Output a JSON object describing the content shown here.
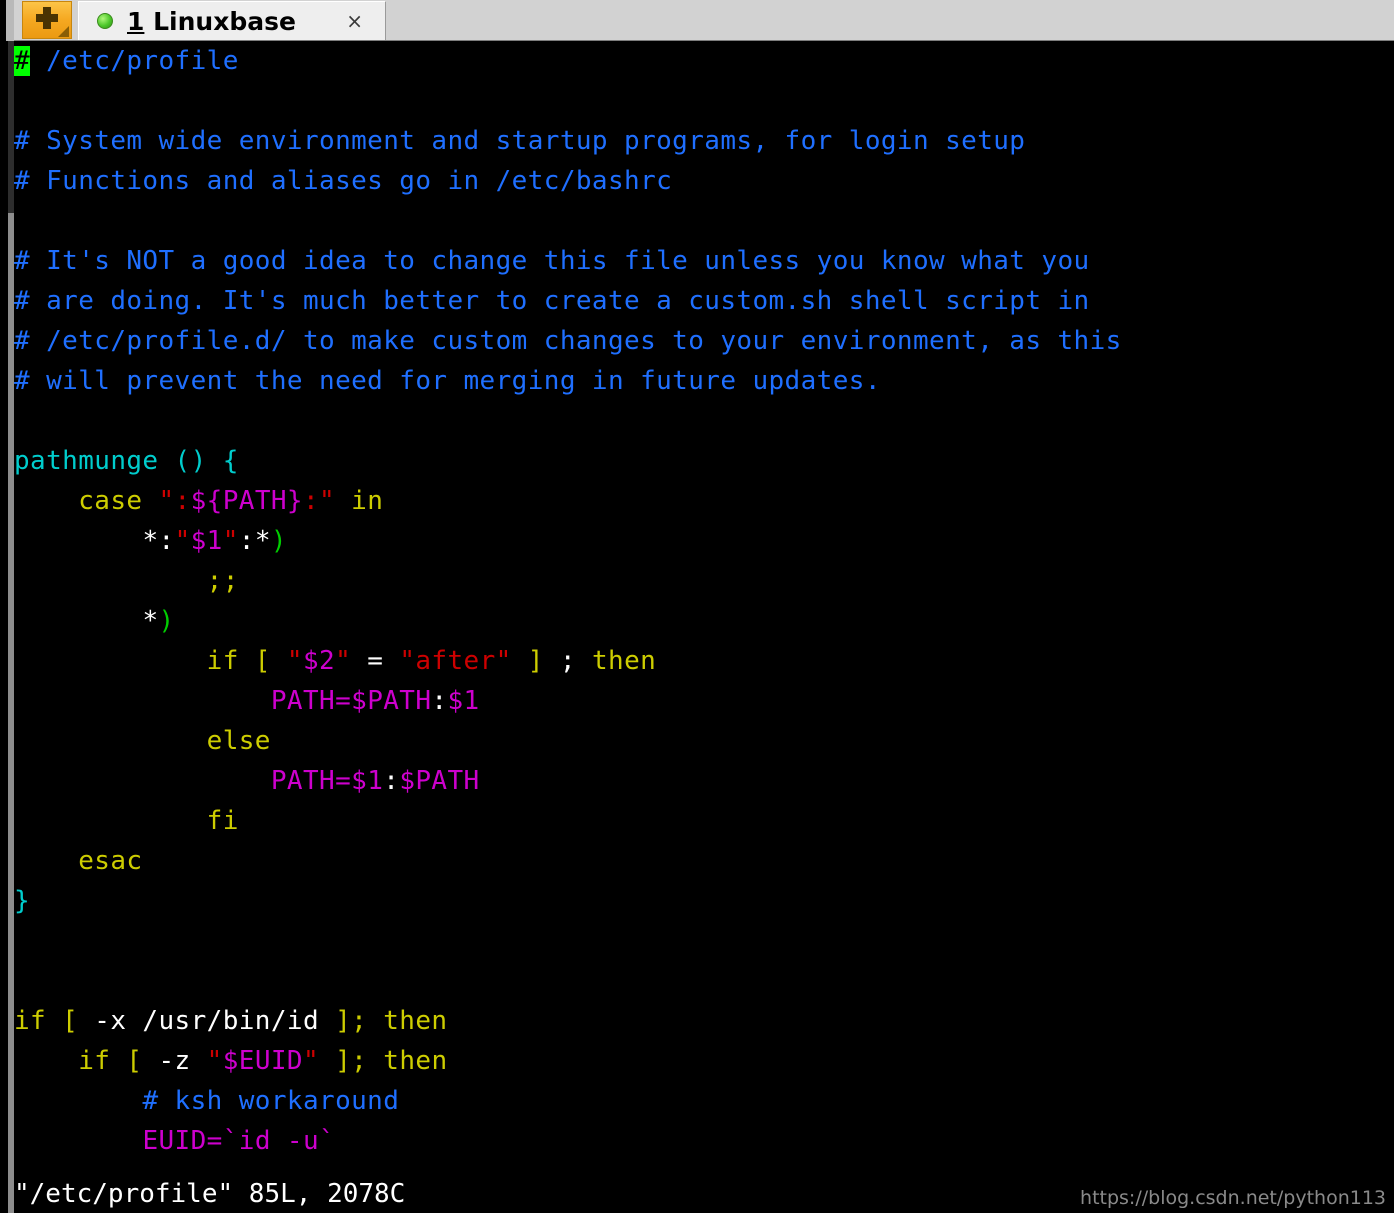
{
  "window": {
    "title": "1 Linuxbase",
    "background_color": "#000000",
    "chrome_color": "#d2d2d2"
  },
  "tabbar": {
    "new_tab_button": {
      "icon": "plus-icon",
      "tooltip": "",
      "color": "#f5a821"
    },
    "tab": {
      "status_icon": "green-circle-icon",
      "status_color": "#4cc72a",
      "index_label": "1",
      "name_label": " Linuxbase",
      "close_label": "×"
    }
  },
  "scrollbar": {
    "orientation": "vertical",
    "track_color": "#8d8d8d",
    "thumb_color": "#2d2d2d"
  },
  "editor": {
    "app": "vim",
    "filename": "/etc/profile",
    "cursor": {
      "line": 1,
      "column": 1,
      "char": "#",
      "color": "#00ff00"
    },
    "colors": {
      "comment": "#1f6fff",
      "keyword": "#cdcd00",
      "function": "#00cdcd",
      "identifier": "#cd00cd",
      "string": "#cd0000",
      "special": "#00cd00",
      "normal": "#ffffff"
    },
    "lines": [
      {
        "id": 1,
        "segments": [
          {
            "text": "#",
            "style": "cursor"
          },
          {
            "text": " /etc/profile",
            "style": "comment"
          }
        ]
      },
      {
        "id": 2,
        "segments": []
      },
      {
        "id": 3,
        "segments": [
          {
            "text": "# System wide environment and startup programs, for login setup",
            "style": "comment"
          }
        ]
      },
      {
        "id": 4,
        "segments": [
          {
            "text": "# Functions and aliases go in /etc/bashrc",
            "style": "comment"
          }
        ]
      },
      {
        "id": 5,
        "segments": []
      },
      {
        "id": 6,
        "segments": [
          {
            "text": "# It's NOT a good idea to change this file unless you know what you",
            "style": "comment"
          }
        ]
      },
      {
        "id": 7,
        "segments": [
          {
            "text": "# are doing. It's much better to create a custom.sh shell script in",
            "style": "comment"
          }
        ]
      },
      {
        "id": 8,
        "segments": [
          {
            "text": "# /etc/profile.d/ to make custom changes to your environment, as this",
            "style": "comment"
          }
        ]
      },
      {
        "id": 9,
        "segments": [
          {
            "text": "# will prevent the need for merging in future updates.",
            "style": "comment"
          }
        ]
      },
      {
        "id": 10,
        "segments": []
      },
      {
        "id": 11,
        "segments": [
          {
            "text": "pathmunge () {",
            "style": "function"
          }
        ]
      },
      {
        "id": 12,
        "segments": [
          {
            "text": "    ",
            "style": "normal"
          },
          {
            "text": "case",
            "style": "keyword"
          },
          {
            "text": " ",
            "style": "normal"
          },
          {
            "text": "\":",
            "style": "string"
          },
          {
            "text": "${PATH}",
            "style": "identifier"
          },
          {
            "text": ":\"",
            "style": "string"
          },
          {
            "text": " ",
            "style": "normal"
          },
          {
            "text": "in",
            "style": "keyword"
          }
        ]
      },
      {
        "id": 13,
        "segments": [
          {
            "text": "        ",
            "style": "normal"
          },
          {
            "text": "*",
            "style": "normal"
          },
          {
            "text": ":",
            "style": "normal"
          },
          {
            "text": "\"",
            "style": "string"
          },
          {
            "text": "$1",
            "style": "identifier"
          },
          {
            "text": "\"",
            "style": "string"
          },
          {
            "text": ":",
            "style": "normal"
          },
          {
            "text": "*",
            "style": "normal"
          },
          {
            "text": ")",
            "style": "special"
          }
        ]
      },
      {
        "id": 14,
        "segments": [
          {
            "text": "            ",
            "style": "normal"
          },
          {
            "text": ";;",
            "style": "keyword"
          }
        ]
      },
      {
        "id": 15,
        "segments": [
          {
            "text": "        ",
            "style": "normal"
          },
          {
            "text": "*",
            "style": "normal"
          },
          {
            "text": ")",
            "style": "special"
          }
        ]
      },
      {
        "id": 16,
        "segments": [
          {
            "text": "            ",
            "style": "normal"
          },
          {
            "text": "if [",
            "style": "keyword"
          },
          {
            "text": " ",
            "style": "normal"
          },
          {
            "text": "\"",
            "style": "string"
          },
          {
            "text": "$2",
            "style": "identifier"
          },
          {
            "text": "\"",
            "style": "string"
          },
          {
            "text": " = ",
            "style": "normal"
          },
          {
            "text": "\"after\"",
            "style": "string"
          },
          {
            "text": " ",
            "style": "normal"
          },
          {
            "text": "]",
            "style": "keyword"
          },
          {
            "text": " ; ",
            "style": "normal"
          },
          {
            "text": "then",
            "style": "keyword"
          }
        ]
      },
      {
        "id": 17,
        "segments": [
          {
            "text": "                ",
            "style": "normal"
          },
          {
            "text": "PATH=",
            "style": "identifier"
          },
          {
            "text": "$PATH",
            "style": "identifier"
          },
          {
            "text": ":",
            "style": "normal"
          },
          {
            "text": "$1",
            "style": "identifier"
          }
        ]
      },
      {
        "id": 18,
        "segments": [
          {
            "text": "            ",
            "style": "normal"
          },
          {
            "text": "else",
            "style": "keyword"
          }
        ]
      },
      {
        "id": 19,
        "segments": [
          {
            "text": "                ",
            "style": "normal"
          },
          {
            "text": "PATH=",
            "style": "identifier"
          },
          {
            "text": "$1",
            "style": "identifier"
          },
          {
            "text": ":",
            "style": "normal"
          },
          {
            "text": "$PATH",
            "style": "identifier"
          }
        ]
      },
      {
        "id": 20,
        "segments": [
          {
            "text": "            ",
            "style": "normal"
          },
          {
            "text": "fi",
            "style": "keyword"
          }
        ]
      },
      {
        "id": 21,
        "segments": [
          {
            "text": "    ",
            "style": "normal"
          },
          {
            "text": "esac",
            "style": "keyword"
          }
        ]
      },
      {
        "id": 22,
        "segments": [
          {
            "text": "}",
            "style": "function"
          }
        ]
      },
      {
        "id": 23,
        "segments": []
      },
      {
        "id": 24,
        "segments": []
      },
      {
        "id": 25,
        "segments": [
          {
            "text": "if [",
            "style": "keyword"
          },
          {
            "text": " -x /usr/bin/id ",
            "style": "normal"
          },
          {
            "text": "];",
            "style": "keyword"
          },
          {
            "text": " ",
            "style": "normal"
          },
          {
            "text": "then",
            "style": "keyword"
          }
        ]
      },
      {
        "id": 26,
        "segments": [
          {
            "text": "    ",
            "style": "normal"
          },
          {
            "text": "if [",
            "style": "keyword"
          },
          {
            "text": " -z ",
            "style": "normal"
          },
          {
            "text": "\"",
            "style": "string"
          },
          {
            "text": "$EUID",
            "style": "identifier"
          },
          {
            "text": "\"",
            "style": "string"
          },
          {
            "text": " ",
            "style": "normal"
          },
          {
            "text": "];",
            "style": "keyword"
          },
          {
            "text": " ",
            "style": "normal"
          },
          {
            "text": "then",
            "style": "keyword"
          }
        ]
      },
      {
        "id": 27,
        "segments": [
          {
            "text": "        ",
            "style": "normal"
          },
          {
            "text": "# ksh workaround",
            "style": "comment"
          }
        ]
      },
      {
        "id": 28,
        "segments": [
          {
            "text": "        ",
            "style": "normal"
          },
          {
            "text": "EUID=",
            "style": "identifier"
          },
          {
            "text": "`id -u`",
            "style": "identifier"
          }
        ]
      }
    ]
  },
  "statusline": {
    "text": "\"/etc/profile\" 85L, 2078C"
  },
  "watermark": {
    "text": "https://blog.csdn.net/python113"
  },
  "backdrop": {
    "glyphs": "⎡\nⓐ"
  }
}
